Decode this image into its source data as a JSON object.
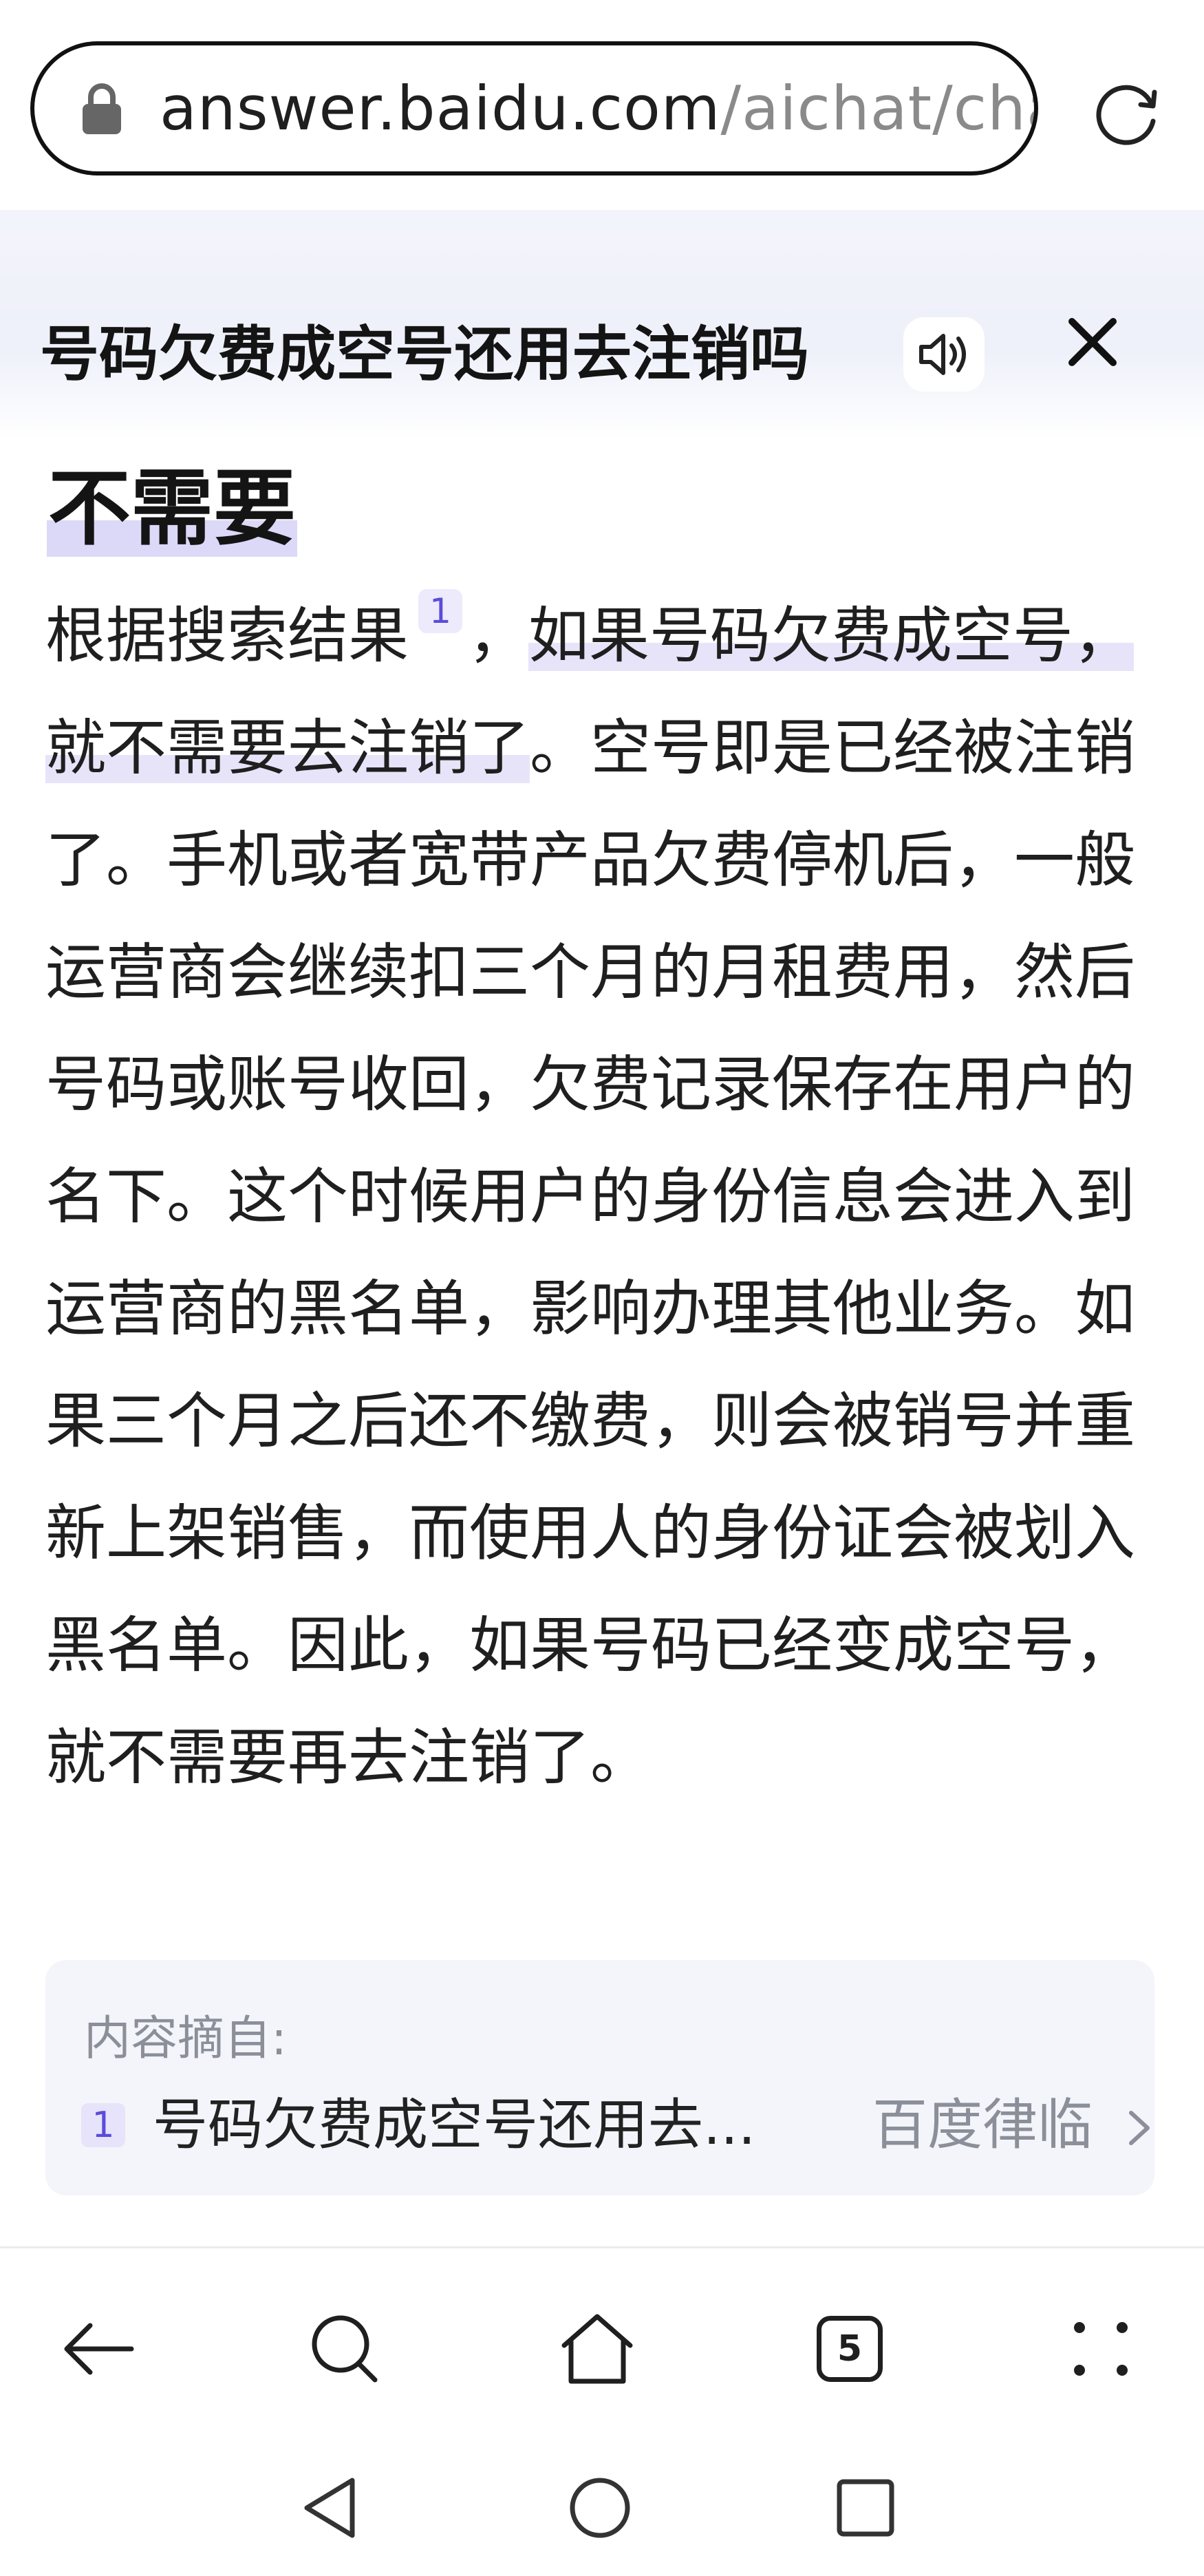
{
  "browser": {
    "url_host": "answer.baidu.com",
    "url_path": "/aichat/chat"
  },
  "header": {
    "question": "号码欠费成空号还用去注销吗"
  },
  "answer": {
    "headline": "不需要",
    "p_lead": "根据搜索结果",
    "cite_num": "1",
    "p_comma": "，",
    "p_highlight": "如果号码欠费成空号，就不需要去注销了",
    "p_rest": "。空号即是已经被注销了。手机或者宽带产品欠费停机后，一般运营商会继续扣三个月的月租费用，然后号码或账号收回，欠费记录保存在用户的名下。这个时候用户的身份信息会进入到运营商的黑名单，影响办理其他业务。如果三个月之后还不缴费，则会被销号并重新上架销售，而使用人的身份证会被划入黑名单。因此，如果号码已经变成空号，就不需要再去注销了。"
  },
  "source_card": {
    "label": "内容摘自:",
    "items": [
      {
        "num": "1",
        "title": "号码欠费成空号还用去...",
        "source": "百度律临"
      }
    ]
  },
  "toolbar": {
    "tab_count": "5"
  },
  "icons": [
    "lock-icon",
    "reload-icon",
    "speaker-icon",
    "close-icon",
    "chevron-right-icon",
    "back-arrow-icon",
    "search-icon",
    "home-icon",
    "tabs-icon",
    "more-icon",
    "nav-back-icon",
    "nav-home-icon",
    "nav-recents-icon"
  ],
  "colors": {
    "accent": "#5b4bdb",
    "highlight": "#e7e4fa",
    "header_bg": "#f3f4fb",
    "card_bg": "#f4f5fa"
  }
}
